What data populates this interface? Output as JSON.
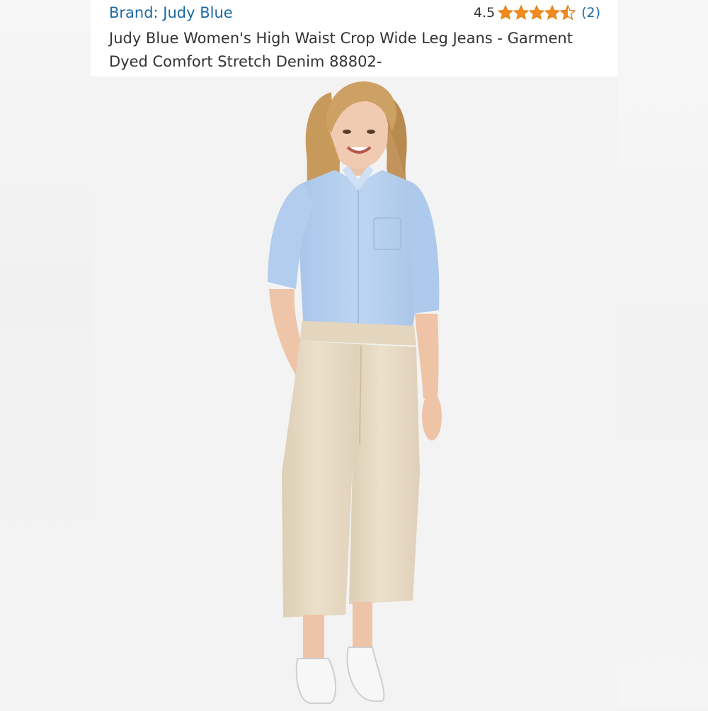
{
  "product": {
    "brand_label": "Brand: Judy Blue",
    "rating_value": "4.5",
    "rating_stars": 4.5,
    "rating_count": "(2)",
    "title": "Judy Blue Women's High Waist Crop Wide Leg Jeans - Garment Dyed Comfort Stretch Denim 88802-"
  },
  "icons": {
    "star": "star-icon",
    "half_star": "half-star-icon"
  },
  "colors": {
    "link": "#1b6aa3",
    "star": "#f28c1f",
    "text": "#333333",
    "shirt": "#b7d1ef",
    "pants": "#e9dcc7",
    "hair": "#c79a5c"
  }
}
